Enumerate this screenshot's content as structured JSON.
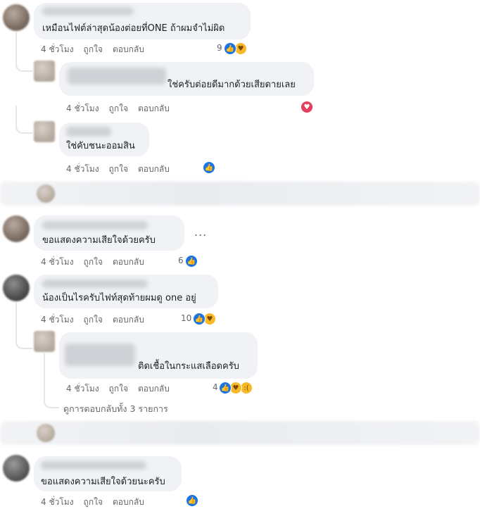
{
  "comments": [
    {
      "text": "เหมือนไฟต์ล่าสุดน้องต่อยที่ONE ถ้าผมจำไม่ผิด",
      "time": "4 ชั่วโมง",
      "like": "ถูกใจ",
      "reply": "ตอบกลับ",
      "count": "9",
      "reactions": [
        "like",
        "care"
      ]
    },
    {
      "text": "ใช่ครับต่อยดีมากด้วยเสียดายเลย",
      "time": "4 ชั่วโมง",
      "like": "ถูกใจ",
      "reply": "ตอบกลับ",
      "count": "",
      "reactions": [
        "love"
      ]
    },
    {
      "text": "ใช่คับชนะออมสิน",
      "time": "4 ชั่วโมง",
      "like": "ถูกใจ",
      "reply": "ตอบกลับ",
      "count": "",
      "reactions": [
        "like"
      ]
    },
    {
      "text": "ขอแสดงความเสียใจด้วยครับ",
      "time": "4 ชั่วโมง",
      "like": "ถูกใจ",
      "reply": "ตอบกลับ",
      "count": "6",
      "reactions": [
        "like"
      ]
    },
    {
      "text": "น้องเป็นไรครับไฟท์สุดท้ายผมดู one อยู่",
      "time": "4 ชั่วโมง",
      "like": "ถูกใจ",
      "reply": "ตอบกลับ",
      "count": "10",
      "reactions": [
        "like",
        "care"
      ]
    },
    {
      "text": "ติดเชื้อในกระแสเลือดครับ",
      "time": "4 ชั่วโมง",
      "like": "ถูกใจ",
      "reply": "ตอบกลับ",
      "count": "4",
      "reactions": [
        "like",
        "care",
        "sad"
      ]
    },
    {
      "text": "ขอแสดงความเสียใจด้วยนะครับ",
      "time": "4 ชั่วโมง",
      "like": "ถูกใจ",
      "reply": "ตอบกลับ",
      "count": "",
      "reactions": [
        "like"
      ]
    }
  ],
  "view_replies": "ดูการตอบกลับทั้ง 3 รายการ",
  "more_menu": "...",
  "icons": {
    "like": "thumbs-up-icon",
    "love": "heart-icon",
    "care": "care-icon",
    "sad": "sad-icon"
  },
  "colors": {
    "like": "#1b74e4",
    "love": "#e4405f",
    "care": "#f7b928",
    "bubble": "#f0f2f5",
    "meta": "#65676b"
  }
}
